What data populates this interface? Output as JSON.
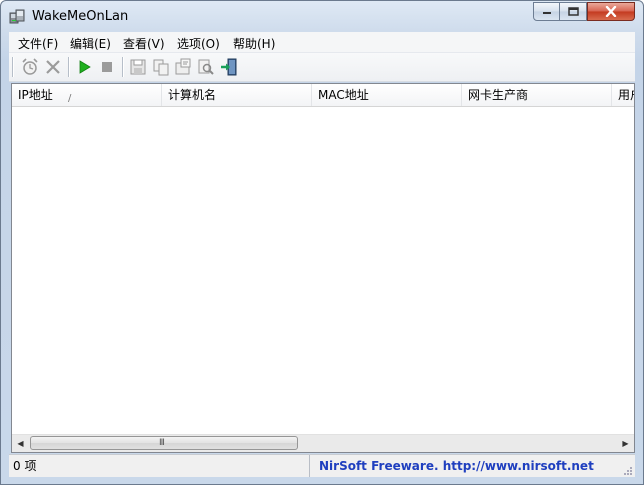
{
  "window": {
    "title": "WakeMeOnLan"
  },
  "menu": {
    "items": [
      {
        "label": "文件(F)"
      },
      {
        "label": "编辑(E)"
      },
      {
        "label": "查看(V)"
      },
      {
        "label": "选项(O)"
      },
      {
        "label": "帮助(H)"
      }
    ]
  },
  "toolbar": {
    "buttons": [
      "alarm-clock-icon",
      "delete-icon",
      "play-icon",
      "stop-icon",
      "save-icon",
      "copy-icon",
      "properties-icon",
      "find-icon",
      "exit-icon"
    ],
    "play_color": "#1fb01f"
  },
  "list": {
    "columns": [
      {
        "label": "IP地址"
      },
      {
        "label": "计算机名"
      },
      {
        "label": "MAC地址"
      },
      {
        "label": "网卡生产商"
      },
      {
        "label": "用户"
      }
    ],
    "sort_glyph": "/",
    "rows": []
  },
  "scrollbar": {
    "grip": "III",
    "left_arrow": "◀",
    "right_arrow": "▶"
  },
  "status": {
    "count": "0 项",
    "credit": "NirSoft Freeware.  http://www.nirsoft.net",
    "credit_color": "#1f3fbf"
  }
}
